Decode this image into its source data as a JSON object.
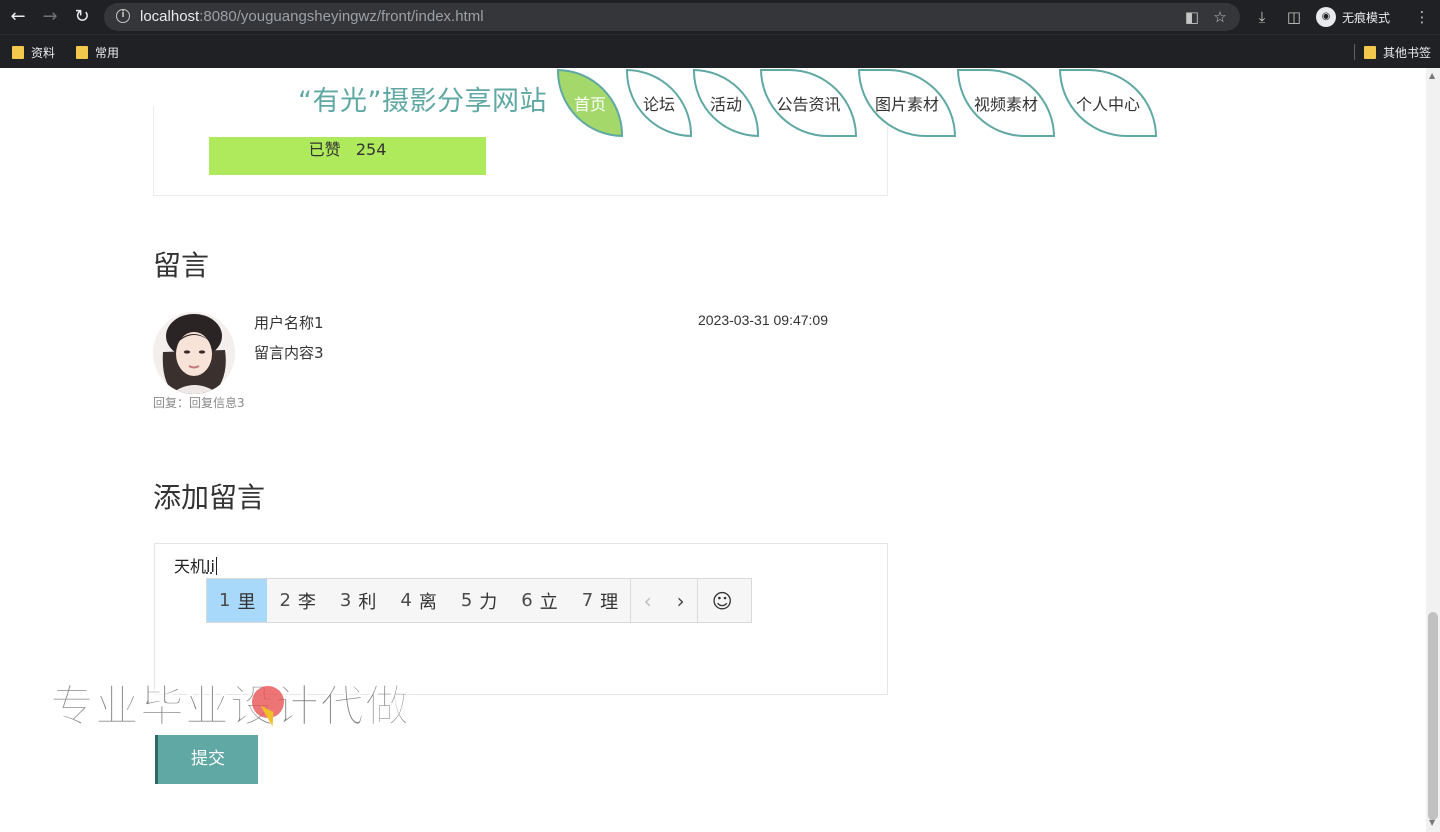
{
  "browser": {
    "url_host": "localhost",
    "url_rest": ":8080/youguangsheyingwz/front/index.html",
    "incognito_label": "无痕模式",
    "bookmarks": [
      {
        "label": "资料"
      },
      {
        "label": "常用"
      }
    ],
    "other_bookmarks_label": "其他书签"
  },
  "site": {
    "title": "“有光”摄影分享网站",
    "nav": [
      {
        "label": "首页",
        "active": true
      },
      {
        "label": "论坛"
      },
      {
        "label": "活动"
      },
      {
        "label": "公告资讯"
      },
      {
        "label": "图片素材"
      },
      {
        "label": "视频素材"
      },
      {
        "label": "个人中心"
      }
    ]
  },
  "like": {
    "label": "已赞",
    "count": "254"
  },
  "messages": {
    "section_title": "留言",
    "items": [
      {
        "username": "用户名称1",
        "content": "留言内容3",
        "time": "2023-03-31 09:47:09",
        "reply": "回复：回复信息3"
      }
    ]
  },
  "add_message": {
    "section_title": "添加留言",
    "input_text": "天机",
    "ime_composition": "li",
    "submit_label": "提交"
  },
  "ime": {
    "candidates": [
      {
        "num": "1",
        "text": "里"
      },
      {
        "num": "2",
        "text": "李"
      },
      {
        "num": "3",
        "text": "利"
      },
      {
        "num": "4",
        "text": "离"
      },
      {
        "num": "5",
        "text": "力"
      },
      {
        "num": "6",
        "text": "立"
      },
      {
        "num": "7",
        "text": "理"
      }
    ],
    "prev_symbol": "‹",
    "next_symbol": "›",
    "emoji_symbol": "☺"
  },
  "watermark": {
    "text": "专业毕业设计代做"
  },
  "colors": {
    "brand": "#5fa8a4",
    "nav_active": "#a4d86b",
    "like_button": "#aeea5c",
    "ime_selected": "#a8d8fa"
  },
  "icons": {
    "back": "arrow-left-icon",
    "forward": "arrow-right-icon",
    "reload": "reload-icon",
    "info": "info-icon",
    "star": "star-icon",
    "folder": "folder-icon"
  }
}
